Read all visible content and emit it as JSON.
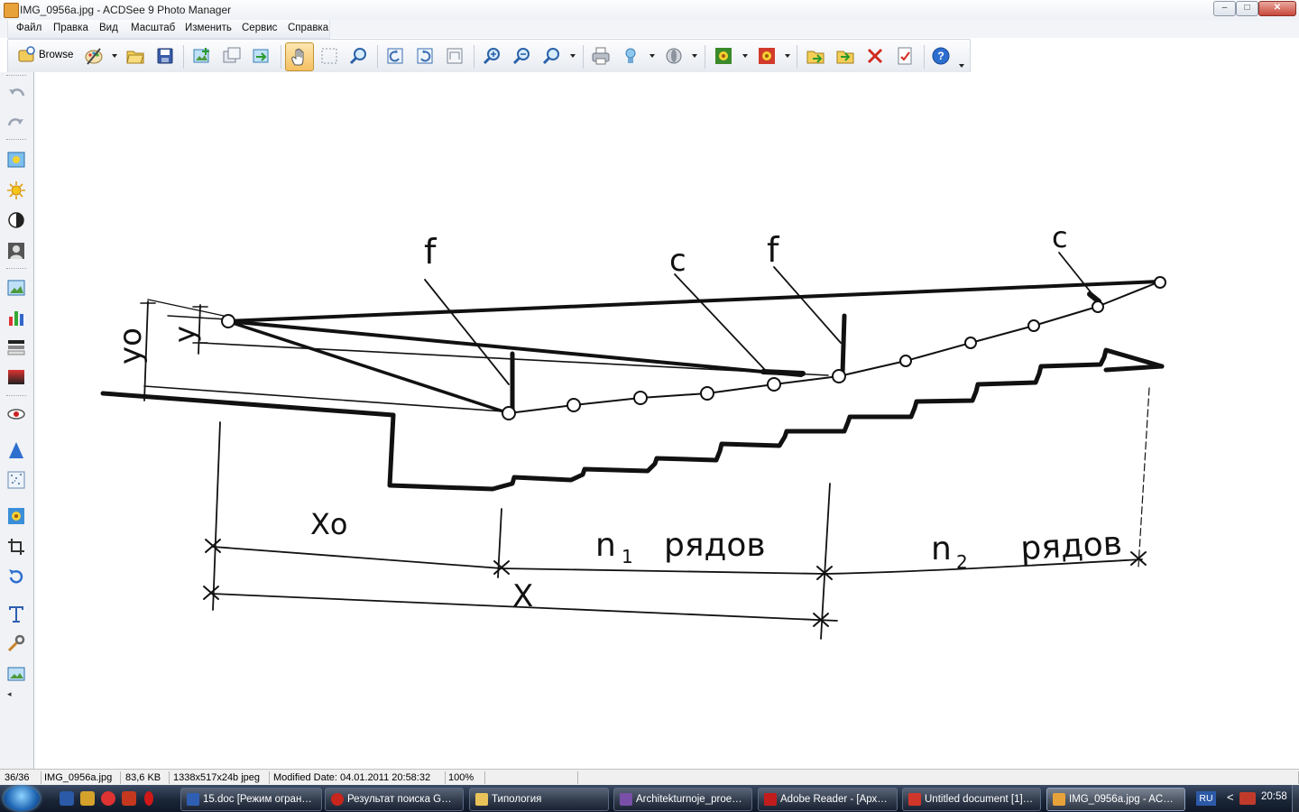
{
  "window": {
    "title": "IMG_0956a.jpg - ACDSee 9 Photo Manager",
    "minimize": "–",
    "maximize": "□",
    "close": "✕"
  },
  "menu": {
    "items": [
      "Файл",
      "Правка",
      "Вид",
      "Масштаб",
      "Изменить",
      "Сервис",
      "Справка"
    ]
  },
  "toolbar": {
    "browse_label": "Browse",
    "buttons": [
      "browse-icon",
      "edit-palette-icon",
      "open-folder-icon",
      "save-icon",
      "acquire-icon",
      "copy-icon",
      "export-icon",
      "hand-icon",
      "select-icon",
      "zoom-select-icon",
      "rotate-left-icon",
      "rotate-right-icon",
      "auto-lens-icon",
      "zoom-in-icon",
      "zoom-out-icon",
      "zoom-icon",
      "print-icon",
      "share-icon",
      "slideshow-icon",
      "set-wallpaper-icon",
      "effects-icon",
      "move-to-icon",
      "copy-to-icon",
      "delete-icon",
      "properties-icon",
      "help-icon"
    ]
  },
  "sidebar": {
    "tools": [
      "undo-icon",
      "redo-icon",
      "auto-exposure-icon",
      "lighting-icon",
      "contrast-icon",
      "portrait-icon",
      "photo-fix-icon",
      "levels-icon",
      "color-balance-icon",
      "gradient-icon",
      "red-eye-icon",
      "sharpen-icon",
      "noise-icon",
      "flower-effect-icon",
      "crop-icon",
      "rotate-icon",
      "text-icon",
      "repair-icon",
      "wallpaper-icon"
    ]
  },
  "drawing": {
    "labels": {
      "f_left": "f",
      "c_left": "c",
      "f_right": "f",
      "c_right": "c",
      "y0": "yo",
      "y": "y",
      "x0": "Xo",
      "x": "X",
      "n1": "n",
      "n1_sub": "1",
      "n1_rows": "рядов",
      "n2": "n",
      "n2_sub": "2",
      "n2_rows": "рядов"
    }
  },
  "status": {
    "index": "36/36",
    "filename": "IMG_0956a.jpg",
    "filesize": "83,6 KB",
    "dimensions": "1338x517x24b jpeg",
    "modified": "Modified Date: 04.01.2011 20:58:32",
    "zoom": "100%"
  },
  "taskbar": {
    "tasks": [
      {
        "label": "15.doc [Режим огран…",
        "color": "#2f5fb3"
      },
      {
        "label": "Результат поиска G…",
        "color": "#c8261d"
      },
      {
        "label": "Типология",
        "color": "#e9c35a"
      },
      {
        "label": "Architekturnoje_proe…",
        "color": "#7a4fa8"
      },
      {
        "label": "Adobe Reader - [Арх…",
        "color": "#c21d1d"
      },
      {
        "label": "Untitled document [1]…",
        "color": "#d1362a"
      },
      {
        "label": "IMG_0956a.jpg - AC…",
        "color": "#e8a23a"
      }
    ],
    "language": "RU",
    "tray_arrow": "<",
    "clock": "20:58"
  }
}
